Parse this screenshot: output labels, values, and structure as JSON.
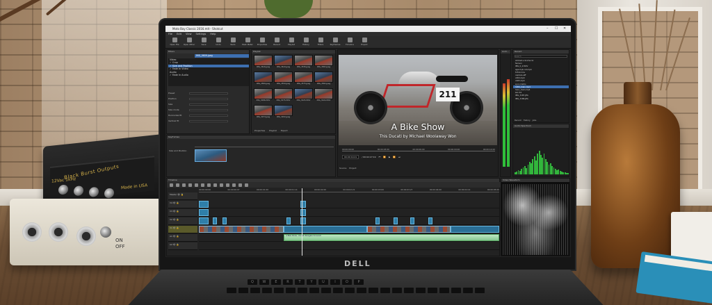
{
  "window": {
    "title": "Moto Bay Classic 2016.mlt - Shotcut",
    "controls": [
      "–",
      "☐",
      "✕"
    ]
  },
  "menu": [
    "File",
    "Edit",
    "View",
    "Settings",
    "Help"
  ],
  "toolbar": [
    "Open File",
    "Open Other",
    "Save",
    "Undo",
    "Redo",
    "Peak Meter",
    "Properties",
    "Recent",
    "Playlist",
    "History",
    "Filters",
    "Keyframes",
    "Timeline",
    "Export"
  ],
  "filters": {
    "title": "Filters",
    "clip_name": "IMG_0609.jpeg",
    "items": [
      {
        "label": "Video",
        "selected": false
      },
      {
        "label": "✓ Crop",
        "selected": false
      },
      {
        "label": "✓ Size and Position",
        "selected": true
      },
      {
        "label": "✓ Fade In Video",
        "selected": false
      },
      {
        "label": "Audio",
        "selected": false
      },
      {
        "label": "✓ Fade In Audio",
        "selected": false
      }
    ],
    "fields": [
      "Preset",
      "Position",
      "Size",
      "Size mode",
      "Horizontal fit",
      "Vertical fit"
    ]
  },
  "playlist": {
    "title": "Playlist",
    "thumbs": [
      "IMG_3616.jpeg",
      "IMG_3610.jpeg",
      "IMG_3536.jpeg",
      "IMG_3582.jpeg",
      "IMG_3580.jpeg",
      "IMG_3550.jpeg",
      "IMG_3575.jpeg",
      "IMG_3582.jpeg",
      "IMG_3086.MOV",
      "IMG_3075.MOV",
      "IMG_3025.MOV",
      "IMG_3024.MOV",
      "IMG_3073.jpeg",
      "IMG_3032.jpeg"
    ],
    "tabs": [
      "Properties",
      "Playlist",
      "Export"
    ]
  },
  "viewer": {
    "title": "A Bike Show",
    "subtitle": "This Ducati by Michael Woolaway Won",
    "plate": "211",
    "ruler": [
      "00:00:00:00",
      "00:00:03:00",
      "00:00:06:00",
      "00:00:09:00",
      "00:00:12:00"
    ],
    "timecode": "00:00:19:21",
    "duration": "/ 00:02:27:19",
    "tabs": [
      "Source",
      "Project"
    ]
  },
  "peak_meter": {
    "title": "Audi..."
  },
  "recent": {
    "title": "Recent",
    "search_placeholder": "search",
    "items": [
      "adobe2+cinema.dv",
      "fwd.avi",
      "IMG_0_2.MOV",
      "agent-pt-cut.mp4",
      "ToFull.mov",
      "capture.aiff",
      "x264.mp4",
      "x265.mp4",
      "sync-marks",
      "h264_main.mp4",
      "hevc_main.mp4",
      "kal.m4",
      "IMG_3187.JPG",
      "IMG_3186.JPG"
    ],
    "selected_index": 9,
    "tabs": [
      "Recent",
      "History",
      "Jobs"
    ]
  },
  "spectrum": {
    "title": "Audio Spectrum"
  },
  "keyframes": {
    "title": "Keyframes",
    "track_label": "Size and Position"
  },
  "timeline": {
    "title": "Timeline",
    "ruler": [
      "00:00:00:00",
      "00:00:00:07",
      "00:00:01:00",
      "00:00:01:14",
      "00:00:02:00",
      "00:00:02:21",
      "00:00:03:00",
      "00:00:03:27",
      "00:00:04:00",
      "00:00:04:14",
      "00:00:05:00"
    ],
    "tracks": [
      "Master",
      "V4",
      "V3",
      "V2",
      "V1",
      "A1",
      "A2"
    ],
    "audio_clip": "A Bike Show - Ducati Panigale Vroooom"
  },
  "scope": {
    "title": "Video Waveform"
  },
  "laptop": {
    "brand": "DELL"
  },
  "gear": {
    "label": "Black Burst Outputs",
    "label2": "12Vac  1kHz",
    "made": "Made in USA",
    "switch": "ON\nOFF"
  },
  "keyboard_row": [
    "Q",
    "W",
    "E",
    "R",
    "T",
    "Y",
    "U",
    "I",
    "O",
    "P"
  ]
}
